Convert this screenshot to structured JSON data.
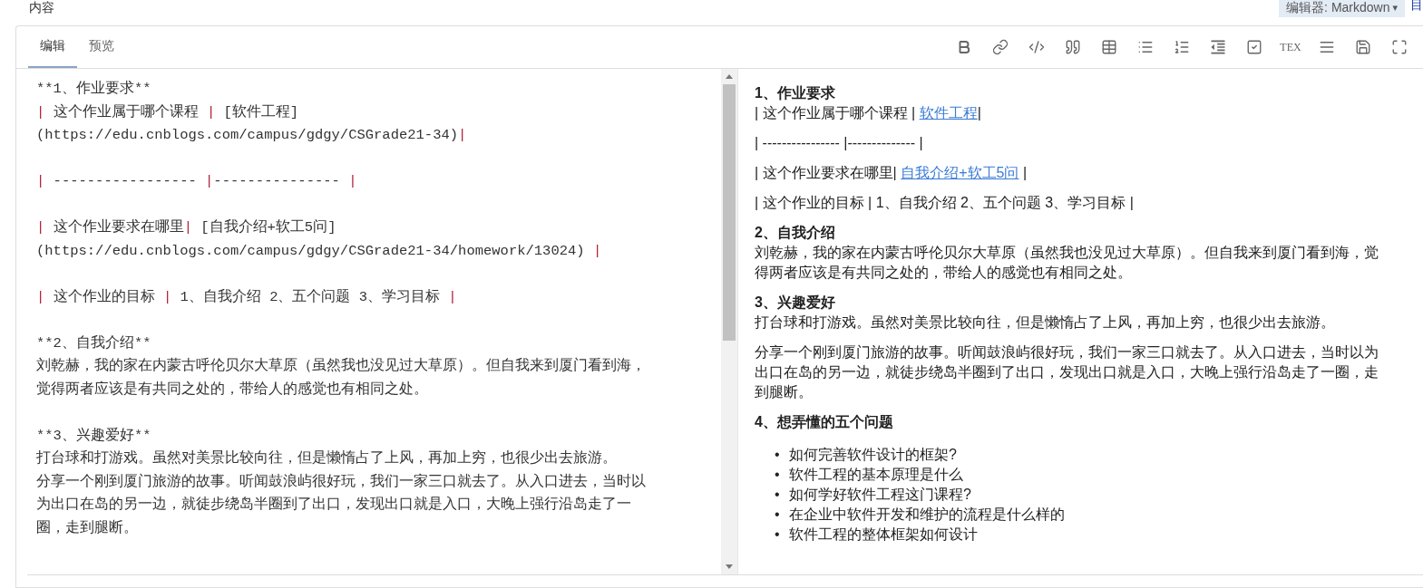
{
  "field_label": "内容",
  "editor_switch": {
    "label": "编辑器: Markdown",
    "caret": "▾"
  },
  "toc_link": "目",
  "tabs": [
    {
      "label": "编辑",
      "selected": true
    },
    {
      "label": "预览",
      "selected": false
    }
  ],
  "toolbar": [
    {
      "kind": "bold"
    },
    {
      "kind": "link"
    },
    {
      "kind": "code"
    },
    {
      "kind": "quote"
    },
    {
      "kind": "table"
    },
    {
      "kind": "bullets"
    },
    {
      "kind": "numbers"
    },
    {
      "kind": "outdent"
    },
    {
      "kind": "task"
    },
    {
      "kind": "tex",
      "label": "TEX"
    },
    {
      "kind": "justify"
    },
    {
      "kind": "save"
    },
    {
      "kind": "fullscreen"
    }
  ],
  "source": [
    {
      "lines": [
        {
          "kind": "text",
          "text": "**1、作业要求**"
        },
        {
          "kind": "table",
          "text": "| 这个作业属于哪个课程 | [软件工程]"
        },
        {
          "kind": "table",
          "text": "(https://edu.cnblogs.com/campus/gdgy/CSGrade21-34)|"
        }
      ]
    },
    {
      "lines": [
        {
          "kind": "table",
          "text": "| ----------------- |--------------- |"
        }
      ]
    },
    {
      "lines": [
        {
          "kind": "table",
          "text": "| 这个作业要求在哪里| [自我介绍+软工5问]"
        },
        {
          "kind": "table",
          "text": "(https://edu.cnblogs.com/campus/gdgy/CSGrade21-34/homework/13024) |"
        }
      ]
    },
    {
      "lines": [
        {
          "kind": "table",
          "text": "| 这个作业的目标 | 1、自我介绍 2、五个问题 3、学习目标 |"
        }
      ]
    },
    {
      "lines": [
        {
          "kind": "text",
          "text": "**2、自我介绍**"
        },
        {
          "kind": "text",
          "text": "刘乾赫，我的家在内蒙古呼伦贝尔大草原（虽然我也没见过大草原）。但自我来到厦门看到海，"
        },
        {
          "kind": "text",
          "text": "觉得两者应该是有共同之处的，带给人的感觉也有相同之处。"
        }
      ]
    },
    {
      "lines": [
        {
          "kind": "text",
          "text": "**3、兴趣爱好**"
        },
        {
          "kind": "text",
          "text": "打台球和打游戏。虽然对美景比较向往，但是懒惰占了上风，再加上穷，也很少出去旅游。"
        },
        {
          "kind": "text",
          "text": "分享一个刚到厦门旅游的故事。听闻鼓浪屿很好玩，我们一家三口就去了。从入口进去，当时以"
        },
        {
          "kind": "text",
          "text": "为出口在岛的另一边，就徒步绕岛半圈到了出口，发现出口就是入口，大晚上强行沿岛走了一"
        },
        {
          "kind": "text",
          "text": "圈，走到腿断。"
        }
      ]
    }
  ],
  "preview": [
    {
      "kind": "heading",
      "text": "1、作业要求"
    },
    {
      "kind": "row",
      "parts": [
        {
          "kind": "text",
          "text": "| 这个作业属于哪个课程 | "
        },
        {
          "kind": "link",
          "text": "软件工程"
        },
        {
          "kind": "text",
          "text": "|"
        }
      ]
    },
    {
      "kind": "row",
      "parts": [
        {
          "kind": "text",
          "text": "| ---------------- |-------------- |"
        }
      ]
    },
    {
      "kind": "row",
      "parts": [
        {
          "kind": "text",
          "text": "| 这个作业要求在哪里| "
        },
        {
          "kind": "link",
          "text": "自我介绍+软工5问"
        },
        {
          "kind": "text",
          "text": " |"
        }
      ]
    },
    {
      "kind": "row",
      "parts": [
        {
          "kind": "text",
          "text": "| 这个作业的目标 | 1、自我介绍 2、五个问题 3、学习目标 |"
        }
      ]
    },
    {
      "kind": "heading",
      "text": "2、自我介绍"
    },
    {
      "kind": "paragraph",
      "text": "刘乾赫，我的家在内蒙古呼伦贝尔大草原（虽然我也没见过大草原）。但自我来到厦门看到海，觉得两者应该是有共同之处的，带给人的感觉也有相同之处。"
    },
    {
      "kind": "heading",
      "text": "3、兴趣爱好"
    },
    {
      "kind": "paragraph",
      "text": "打台球和打游戏。虽然对美景比较向往，但是懒惰占了上风，再加上穷，也很少出去旅游。"
    },
    {
      "kind": "paragraph",
      "text": "分享一个刚到厦门旅游的故事。听闻鼓浪屿很好玩，我们一家三口就去了。从入口进去，当时以为出口在岛的另一边，就徒步绕岛半圈到了出口，发现出口就是入口，大晚上强行沿岛走了一圈，走到腿断。"
    },
    {
      "kind": "heading",
      "text": "4、想弄懂的五个问题"
    },
    {
      "kind": "list",
      "marker": "•",
      "items": [
        "如何完善软件设计的框架?",
        "软件工程的基本原理是什么",
        "如何学好软件工程这门课程?",
        "在企业中软件开发和维护的流程是什么样的",
        "软件工程的整体框架如何设计"
      ]
    }
  ]
}
